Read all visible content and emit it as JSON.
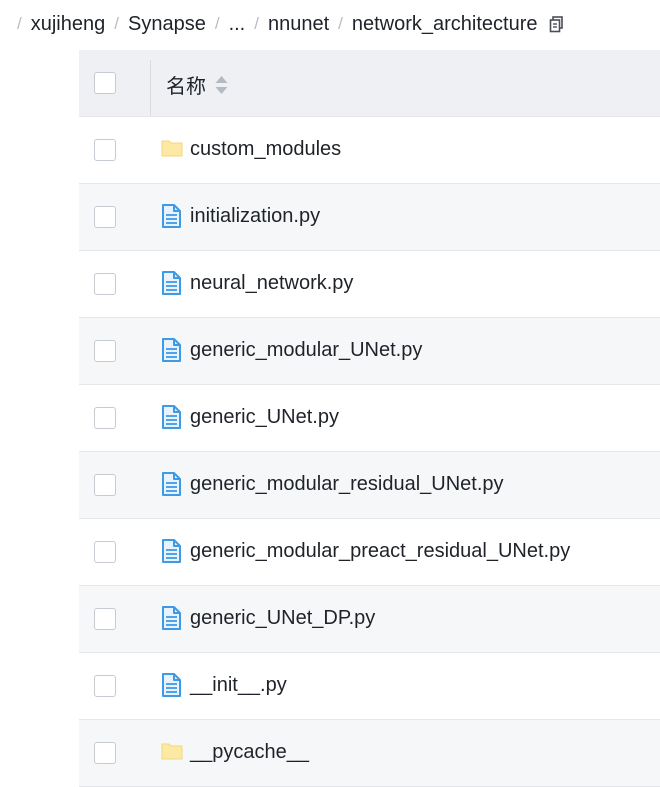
{
  "breadcrumb": {
    "items": [
      "xujiheng",
      "Synapse",
      "...",
      "nnunet",
      "network_architecture"
    ],
    "separator": "/"
  },
  "table": {
    "header": {
      "name_label": "名称"
    },
    "rows": [
      {
        "name": "custom_modules",
        "type": "folder"
      },
      {
        "name": "initialization.py",
        "type": "file"
      },
      {
        "name": "neural_network.py",
        "type": "file"
      },
      {
        "name": "generic_modular_UNet.py",
        "type": "file"
      },
      {
        "name": "generic_UNet.py",
        "type": "file"
      },
      {
        "name": "generic_modular_residual_UNet.py",
        "type": "file"
      },
      {
        "name": "generic_modular_preact_residual_UNet.py",
        "type": "file"
      },
      {
        "name": "generic_UNet_DP.py",
        "type": "file"
      },
      {
        "name": "__init__.py",
        "type": "file"
      },
      {
        "name": "__pycache__",
        "type": "folder"
      }
    ]
  },
  "icons": {
    "folder": "folder-icon",
    "file": "file-icon",
    "copy": "copy-icon",
    "sort": "sort-icon"
  },
  "colors": {
    "folder": "#fce9a4",
    "file": "#3f9ae6",
    "header_bg": "#eef0f4",
    "alt_row_bg": "#f6f7f9"
  }
}
